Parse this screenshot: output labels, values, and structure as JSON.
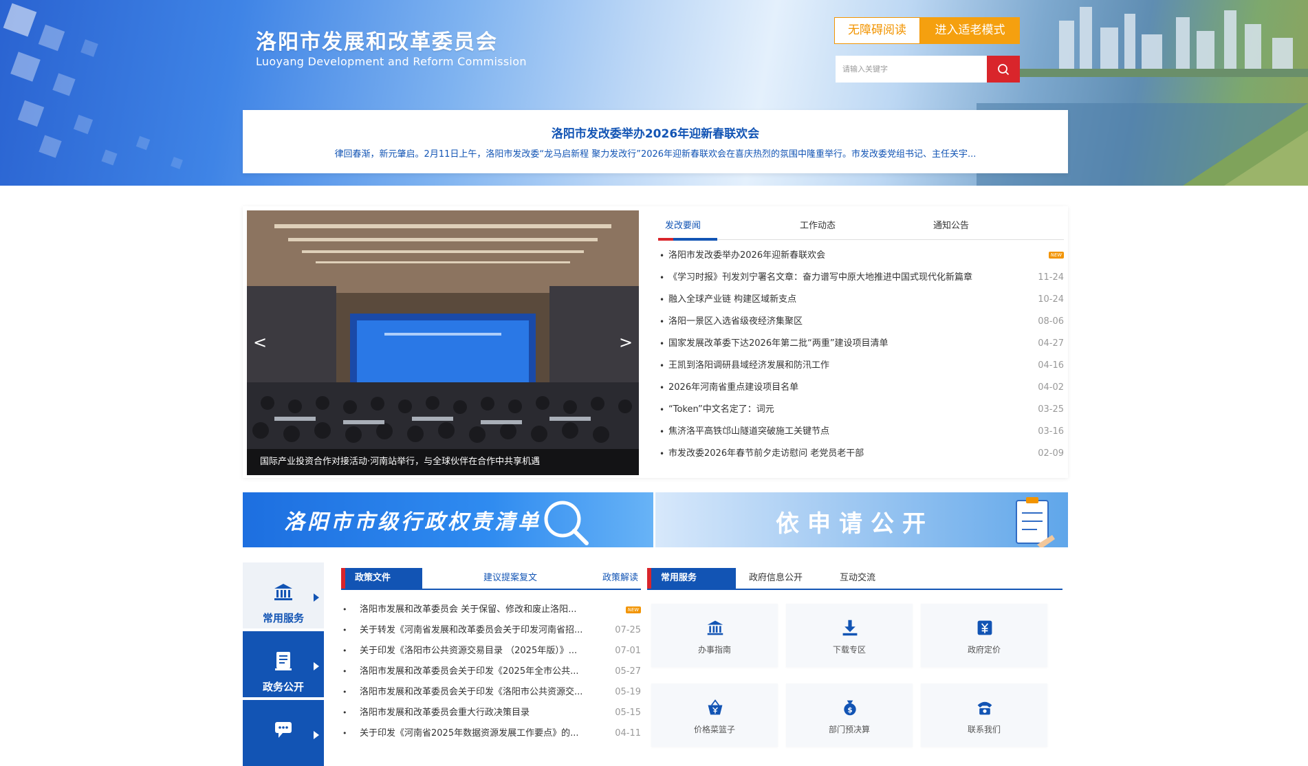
{
  "header": {
    "title": "洛阳市发展和改革委员会",
    "subtitle": "Luoyang Development and Reform Commission",
    "accessible_label": "无障碍阅读",
    "elder_label": "进入适老模式",
    "search_placeholder": "请输入关键字"
  },
  "headline": {
    "title": "洛阳市发改委举办2026年迎新春联欢会",
    "summary": "律回春渐，新元肇启。2月11日上午，洛阳市发改委“龙马启新程 聚力发改行”2026年迎新春联欢会在喜庆热烈的氛围中隆重举行。市发改委党组书记、主任关宇..."
  },
  "carousel": {
    "caption": "国际产业投资合作对接活动·河南站举行，与全球伙伴在合作中共享机遇",
    "prev": "<",
    "next": ">"
  },
  "news_tabs": [
    "发改要闻",
    "工作动态",
    "通知公告"
  ],
  "news": [
    {
      "title": "洛阳市发改委举办2026年迎新春联欢会",
      "date": "",
      "badge": "NEW"
    },
    {
      "title": "《学习时报》刊发刘宁署名文章：奋力谱写中原大地推进中国式现代化新篇章",
      "date": "11-24"
    },
    {
      "title": "融入全球产业链 构建区域新支点",
      "date": "10-24"
    },
    {
      "title": "洛阳一景区入选省级夜经济集聚区",
      "date": "08-06"
    },
    {
      "title": "国家发展改革委下达2026年第二批“两重”建设项目清单",
      "date": "04-27"
    },
    {
      "title": "王凯到洛阳调研县域经济发展和防汛工作",
      "date": "04-16"
    },
    {
      "title": "2026年河南省重点建设项目名单",
      "date": "04-02"
    },
    {
      "title": "“Token”中文名定了：词元",
      "date": "03-25"
    },
    {
      "title": "焦济洛平高铁邙山隧道突破施工关键节点",
      "date": "03-16"
    },
    {
      "title": "市发改委2026年春节前夕走访慰问 老党员老干部",
      "date": "02-09"
    }
  ],
  "banners": {
    "left": "洛阳市市级行政权责清单",
    "right": "依申请公开"
  },
  "side_nav": [
    {
      "label": "常用服务",
      "icon": "bank-icon"
    },
    {
      "label": "政务公开",
      "icon": "document-icon"
    },
    {
      "label": "",
      "icon": "chat-icon"
    }
  ],
  "policy_tabs": [
    "政策文件",
    "建议提案复文",
    "政策解读"
  ],
  "policy_items": [
    {
      "title": "洛阳市发展和改革委员会 关于保留、修改和废止洛阳...",
      "date": "",
      "badge": "NEW"
    },
    {
      "title": "关于转发《河南省发展和改革委员会关于印发河南省招...",
      "date": "07-25"
    },
    {
      "title": "关于印发《洛阳市公共资源交易目录 （2025年版）》...",
      "date": "07-01"
    },
    {
      "title": "洛阳市发展和改革委员会关于印发《2025年全市公共...",
      "date": "05-27"
    },
    {
      "title": "洛阳市发展和改革委员会关于印发《洛阳市公共资源交...",
      "date": "05-19"
    },
    {
      "title": "洛阳市发展和改革委员会重大行政决策目录",
      "date": "05-15"
    },
    {
      "title": "关于印发《河南省2025年数据资源发展工作要点》的...",
      "date": "04-11"
    }
  ],
  "service_tabs": [
    "常用服务",
    "政府信息公开",
    "互动交流"
  ],
  "services": [
    {
      "label": "办事指南",
      "icon": "bank-icon"
    },
    {
      "label": "下载专区",
      "icon": "download-icon"
    },
    {
      "label": "政府定价",
      "icon": "yuan-icon"
    },
    {
      "label": "价格菜篮子",
      "icon": "basket-icon"
    },
    {
      "label": "部门预决算",
      "icon": "moneybag-icon"
    },
    {
      "label": "联系我们",
      "icon": "phone-icon"
    }
  ],
  "colors": {
    "primary": "#1254b4",
    "accent_red": "#d9252b",
    "accent_orange": "#f29400"
  }
}
